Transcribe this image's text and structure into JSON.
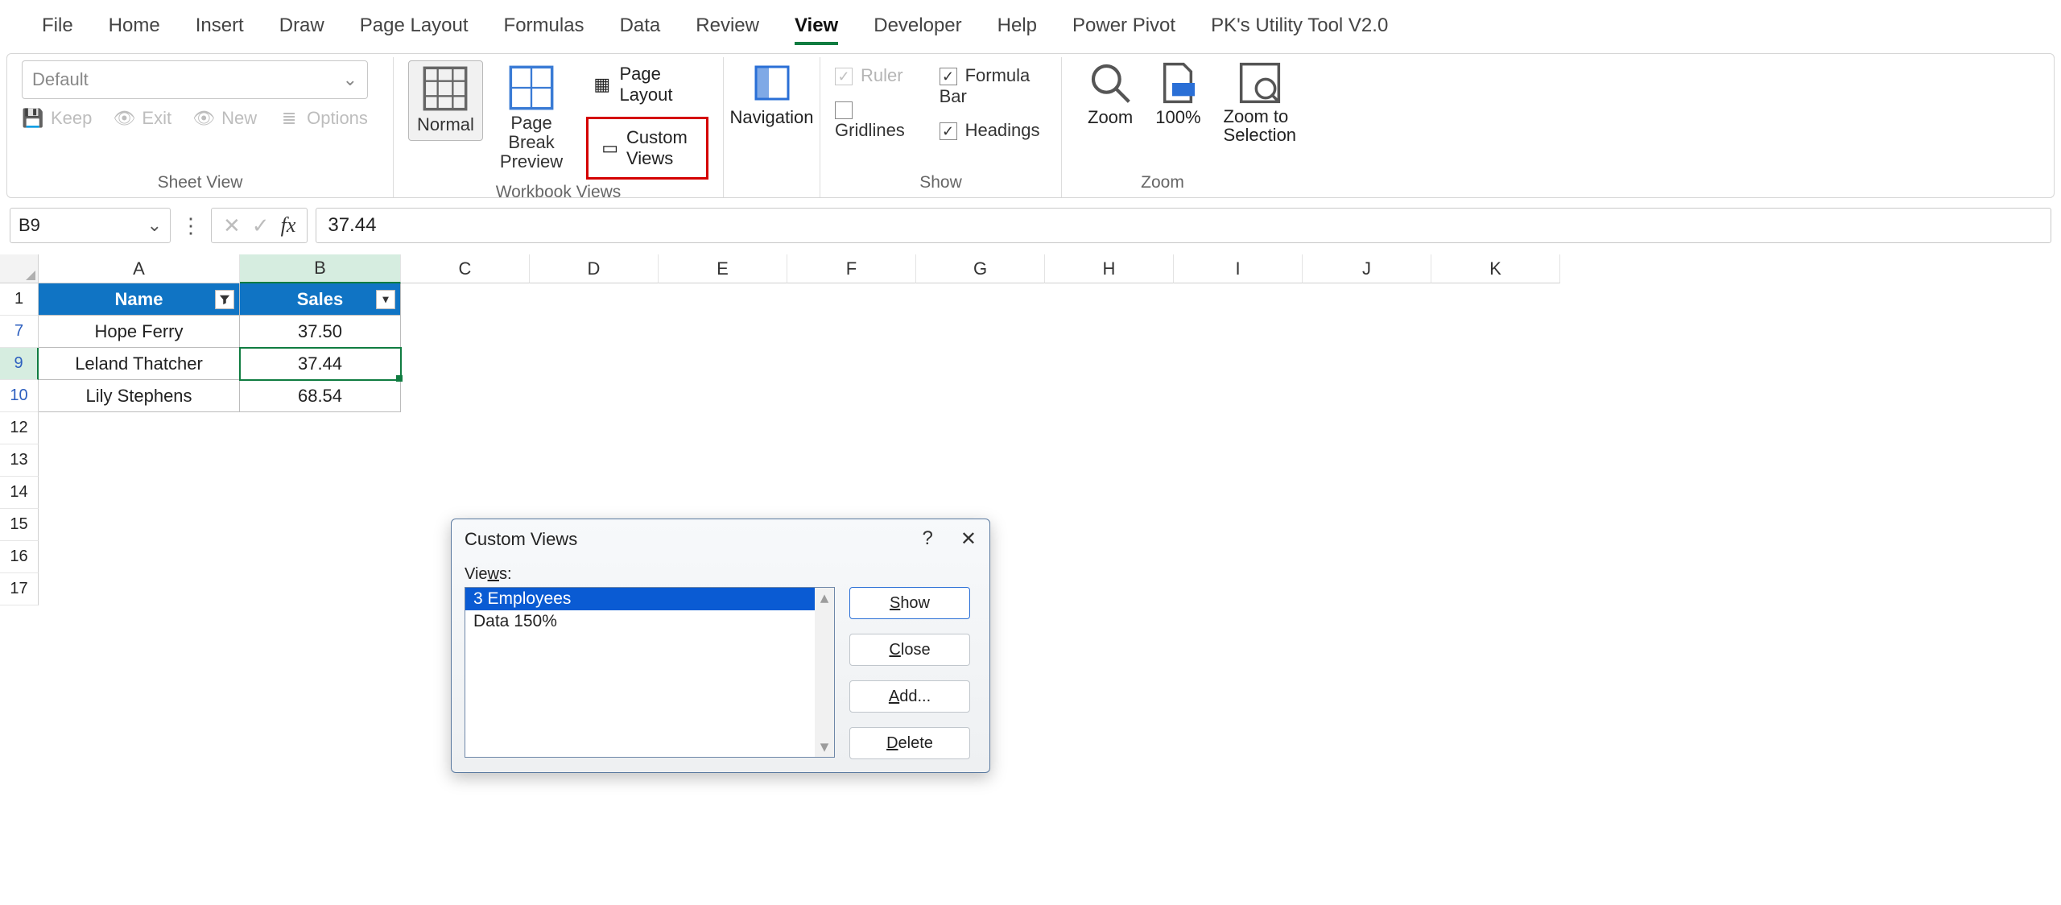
{
  "tabs": [
    "File",
    "Home",
    "Insert",
    "Draw",
    "Page Layout",
    "Formulas",
    "Data",
    "Review",
    "View",
    "Developer",
    "Help",
    "Power Pivot",
    "PK's Utility Tool V2.0"
  ],
  "active_tab": "View",
  "ribbon": {
    "sheet_view": {
      "dropdown": "Default",
      "keep": "Keep",
      "exit": "Exit",
      "new": "New",
      "options": "Options",
      "label": "Sheet View"
    },
    "workbook_views": {
      "normal": "Normal",
      "page_break": "Page Break Preview",
      "page_layout": "Page Layout",
      "custom_views": "Custom Views",
      "label": "Workbook Views"
    },
    "navigation": "Navigation",
    "show": {
      "ruler": "Ruler",
      "gridlines": "Gridlines",
      "formula_bar": "Formula Bar",
      "headings": "Headings",
      "label": "Show"
    },
    "zoom": {
      "zoom": "Zoom",
      "hundred": "100%",
      "zts": "Zoom to Selection",
      "label": "Zoom"
    }
  },
  "namebox": "B9",
  "formula_value": "37.44",
  "columns": [
    "A",
    "B",
    "C",
    "D",
    "E",
    "F",
    "G",
    "H",
    "I",
    "J",
    "K"
  ],
  "header_row": {
    "name": "Name",
    "sales": "Sales"
  },
  "rows": [
    {
      "n": "1"
    },
    {
      "n": "7",
      "name": "Hope Ferry",
      "sales": "37.50"
    },
    {
      "n": "9",
      "name": "Leland Thatcher",
      "sales": "37.44",
      "selected": true
    },
    {
      "n": "10",
      "name": "Lily Stephens",
      "sales": "68.54"
    },
    {
      "n": "12"
    },
    {
      "n": "13"
    },
    {
      "n": "14"
    },
    {
      "n": "15"
    },
    {
      "n": "16"
    },
    {
      "n": "17"
    }
  ],
  "dialog": {
    "title": "Custom Views",
    "views_label": "Views:",
    "items": [
      "3 Employees",
      "Data 150%"
    ],
    "selected": "3 Employees",
    "buttons": {
      "show": "Show",
      "close": "Close",
      "add": "Add...",
      "delete": "Delete"
    }
  }
}
